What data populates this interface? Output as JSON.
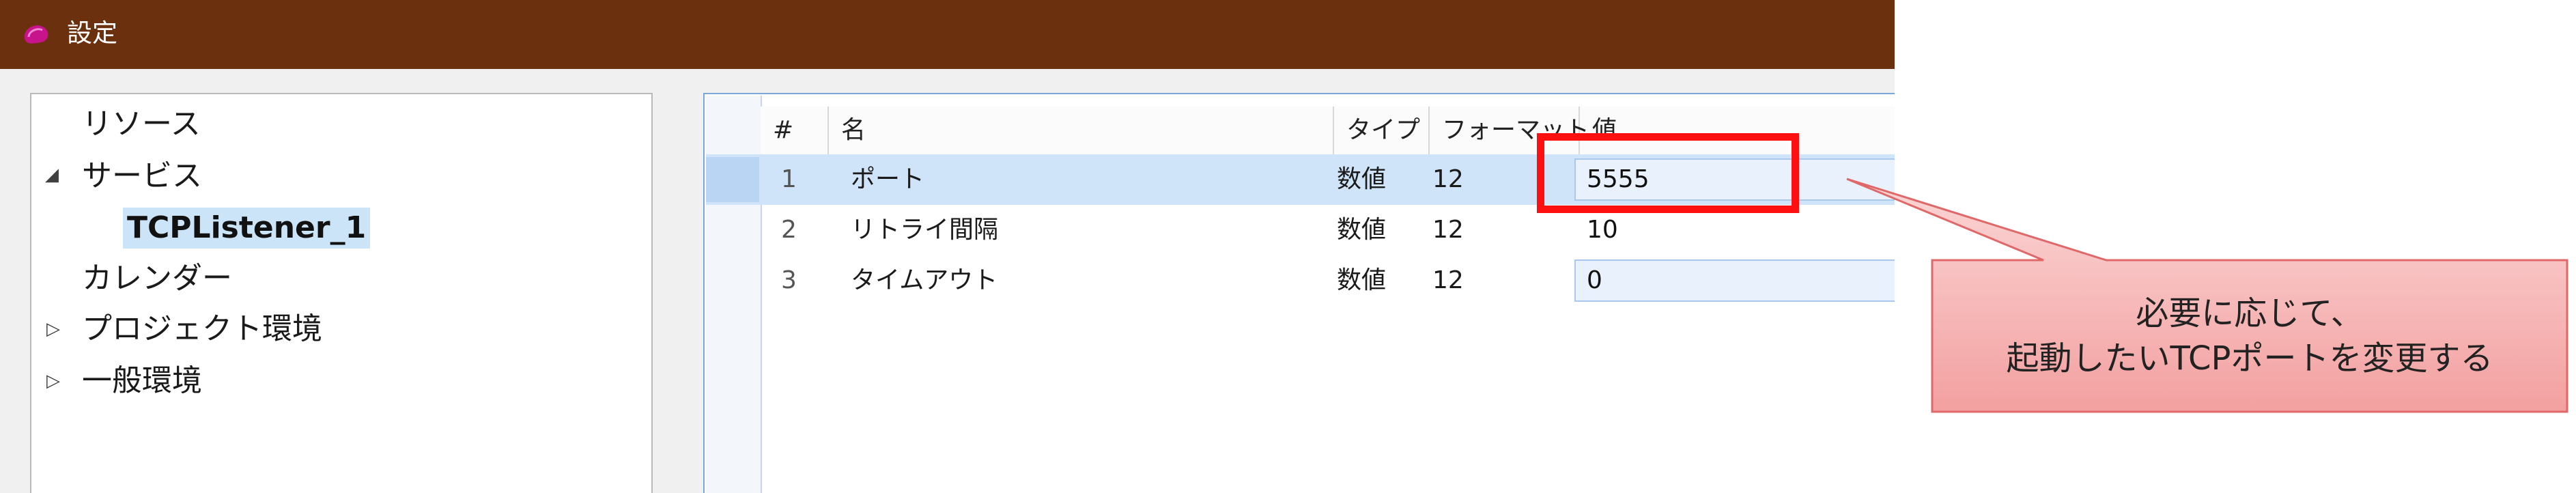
{
  "window": {
    "title": "設定"
  },
  "tree": {
    "items": [
      {
        "label": "リソース",
        "expander": ""
      },
      {
        "label": "サービス",
        "expander": "◢"
      },
      {
        "label": "TCPListener_1",
        "expander": ""
      },
      {
        "label": "カレンダー",
        "expander": ""
      },
      {
        "label": "プロジェクト環境",
        "expander": "▷"
      },
      {
        "label": "一般環境",
        "expander": "▷"
      }
    ]
  },
  "grid": {
    "columns": [
      "#",
      "名",
      "タイプ",
      "フォーマット",
      "値"
    ],
    "rows": [
      {
        "num": "1",
        "name": "ポート",
        "type": "数値",
        "format": "12",
        "value": "5555"
      },
      {
        "num": "2",
        "name": "リトライ間隔",
        "type": "数値",
        "format": "12",
        "value": "10"
      },
      {
        "num": "3",
        "name": "タイムアウト",
        "type": "数値",
        "format": "12",
        "value": "0"
      }
    ]
  },
  "callout": {
    "line1": "必要に応じて、",
    "line2": "起動したいTCPポートを変更する"
  },
  "colors": {
    "titlebar": "#6b300d",
    "highlight": "#ff1010",
    "callout_fill": "#f7b5b5",
    "callout_border": "#e06868",
    "selection": "#cfe3f9"
  }
}
